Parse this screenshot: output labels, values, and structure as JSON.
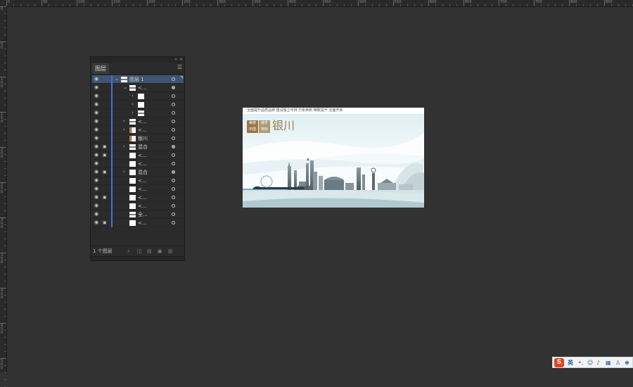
{
  "rulers": {
    "top_labels": [
      "0",
      "50",
      "100",
      "150",
      "200",
      "250",
      "300",
      "350",
      "400",
      "450",
      "500",
      "550",
      "600",
      "650",
      "700",
      "750",
      "800",
      "850"
    ],
    "left_labels": [
      "0",
      "50",
      "100",
      "150",
      "200",
      "250",
      "300",
      "350",
      "400",
      "450",
      "500"
    ]
  },
  "layers_panel": {
    "title": "图层",
    "menu_icon": "menu-icon",
    "layers": [
      {
        "name": "图层 1",
        "locked": false,
        "chevron": "down",
        "indent": 0,
        "thumb": "img",
        "target": "plain",
        "selected": true
      },
      {
        "name": "<...",
        "locked": false,
        "chevron": "down",
        "indent": 1,
        "thumb": "img",
        "target": "fill"
      },
      {
        "name": "",
        "locked": false,
        "chevron": "right",
        "indent": 2,
        "thumb": "white",
        "target": "plain"
      },
      {
        "name": "",
        "locked": false,
        "chevron": "right",
        "indent": 2,
        "thumb": "white",
        "target": "plain"
      },
      {
        "name": "",
        "locked": false,
        "chevron": "right",
        "indent": 2,
        "thumb": "img",
        "target": "plain"
      },
      {
        "name": "<...",
        "locked": false,
        "chevron": "right",
        "indent": 1,
        "thumb": "img",
        "target": "plain"
      },
      {
        "name": "<...",
        "locked": false,
        "chevron": "right",
        "indent": 1,
        "thumb": "brown",
        "target": "plain"
      },
      {
        "name": "银川",
        "locked": false,
        "chevron": "",
        "indent": 1,
        "thumb": "brown",
        "target": "plain"
      },
      {
        "name": "混合",
        "locked": true,
        "chevron": "right",
        "indent": 1,
        "thumb": "img",
        "target": "fill"
      },
      {
        "name": "<...",
        "locked": true,
        "chevron": "",
        "indent": 1,
        "thumb": "white",
        "target": "plain"
      },
      {
        "name": "<...",
        "locked": false,
        "chevron": "",
        "indent": 1,
        "thumb": "white",
        "target": "plain"
      },
      {
        "name": "混合",
        "locked": true,
        "chevron": "right",
        "indent": 1,
        "thumb": "white",
        "target": "fill"
      },
      {
        "name": "<...",
        "locked": false,
        "chevron": "",
        "indent": 1,
        "thumb": "white",
        "target": "plain"
      },
      {
        "name": "<...",
        "locked": false,
        "chevron": "",
        "indent": 1,
        "thumb": "white",
        "target": "plain"
      },
      {
        "name": "<...",
        "locked": true,
        "chevron": "",
        "indent": 1,
        "thumb": "white",
        "target": "plain"
      },
      {
        "name": "<...",
        "locked": false,
        "chevron": "",
        "indent": 1,
        "thumb": "white",
        "target": "plain"
      },
      {
        "name": "全...",
        "locked": false,
        "chevron": "",
        "indent": 1,
        "thumb": "img",
        "target": "plain"
      },
      {
        "name": "<...",
        "locked": true,
        "chevron": "",
        "indent": 1,
        "thumb": "white",
        "target": "plain"
      }
    ],
    "footer": {
      "count": "1 个图层",
      "icons": [
        "search-icon",
        "make-clip-mask-icon",
        "new-sublayer-icon",
        "new-layer-icon",
        "delete-icon"
      ]
    }
  },
  "artboard": {
    "tagline": "全面提升品质品牌  建设独立可持  万象焕新  精致提升  全面开启",
    "badge_left": [
      "美丽",
      "中国"
    ],
    "badge_right": [
      "城市",
      "地标"
    ],
    "city_name": "银川"
  },
  "taskbar": {
    "ime_logo": "S",
    "ime_lang": "英",
    "ime_icons": [
      "punctuation-icon",
      "emoji-icon",
      "microphone-icon",
      "keyboard-icon",
      "user-icon",
      "skin-icon"
    ]
  },
  "colors": {
    "canvas_bg": "#323232",
    "panel_bg": "#2b2b2b",
    "selection": "#3e5572",
    "layer_color_bar": "#4a6fd6",
    "city_gold": "#a07e4c",
    "ime_red": "#e8431c"
  }
}
